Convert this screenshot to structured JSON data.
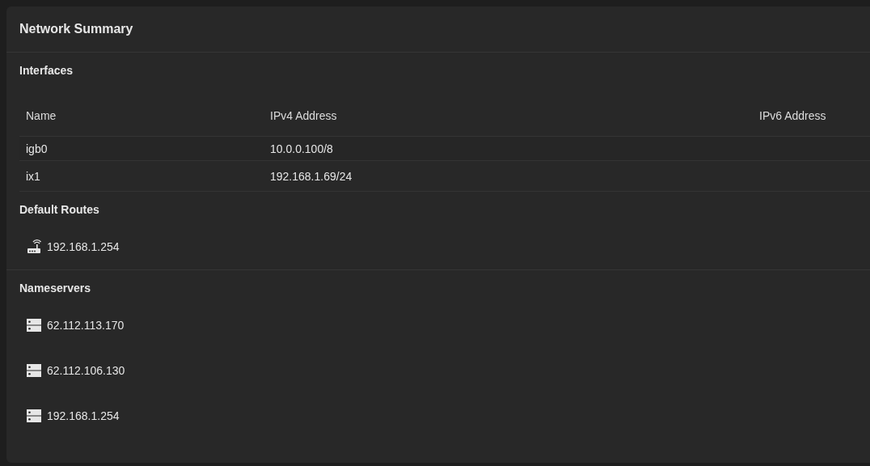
{
  "card": {
    "title": "Network Summary"
  },
  "interfaces": {
    "heading": "Interfaces",
    "columns": [
      "Name",
      "IPv4 Address",
      "IPv6 Address"
    ],
    "rows": [
      [
        "igb0",
        "10.0.0.100/8"
      ],
      [
        "ix1",
        "192.168.1.69/24"
      ]
    ]
  },
  "default_routes": {
    "heading": "Default Routes",
    "items": [
      {
        "kind": "router",
        "address": "192.168.1.254"
      }
    ]
  },
  "nameservers": {
    "heading": "Nameservers",
    "items": [
      {
        "kind": "server",
        "address": "62.112.113.170"
      },
      {
        "kind": "server",
        "address": "62.112.106.130"
      },
      {
        "kind": "server",
        "address": "192.168.1.254"
      }
    ]
  }
}
